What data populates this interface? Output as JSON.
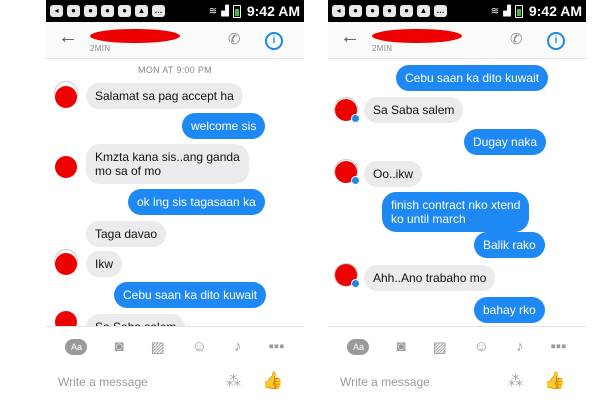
{
  "status_bar": {
    "time": "9:42 AM"
  },
  "header": {
    "time_ago": "2MIN"
  },
  "compose": {
    "placeholder": "Write a message"
  },
  "left": {
    "timestamp": "MON AT 9:00 PM",
    "messages": [
      {
        "dir": "in",
        "text": "Salamat sa pag accept ha"
      },
      {
        "dir": "out",
        "text": "welcome sis"
      },
      {
        "dir": "in",
        "text": "Kmzta kana sis..ang ganda\nmo sa of mo"
      },
      {
        "dir": "out",
        "text": "ok lng sis tagasaan ka"
      },
      {
        "dir": "in",
        "text": "Taga davao"
      },
      {
        "dir": "in",
        "text": "Ikw"
      },
      {
        "dir": "out",
        "text": "Cebu saan ka dito kuwait"
      },
      {
        "dir": "in",
        "text": "Sa Saba salem"
      }
    ]
  },
  "right": {
    "messages": [
      {
        "dir": "out",
        "text": "Cebu saan ka dito kuwait"
      },
      {
        "dir": "in",
        "text": "Sa Saba salem"
      },
      {
        "dir": "out",
        "text": "Dugay naka"
      },
      {
        "dir": "in",
        "text": "Oo..ikw"
      },
      {
        "dir": "out",
        "text": "finish contract nko xtend\nko until march"
      },
      {
        "dir": "out",
        "text": "Balik rako"
      },
      {
        "dir": "in",
        "text": "Ahh..Ano trabaho mo"
      },
      {
        "dir": "out",
        "text": "bahay rko"
      }
    ]
  },
  "icons": {
    "back": "back-arrow-icon",
    "call": "phone-icon",
    "info": "info-icon",
    "camera": "camera-icon",
    "gallery": "image-icon",
    "emoji": "emoji-icon",
    "mic": "microphone-icon",
    "more": "more-icon",
    "sticker": "sticker-icon",
    "like": "thumbs-up-icon"
  },
  "colors": {
    "outgoing": "#1e88f5",
    "incoming": "#eceaec",
    "accent": "#1e88e5",
    "redaction": "#ee0000"
  }
}
